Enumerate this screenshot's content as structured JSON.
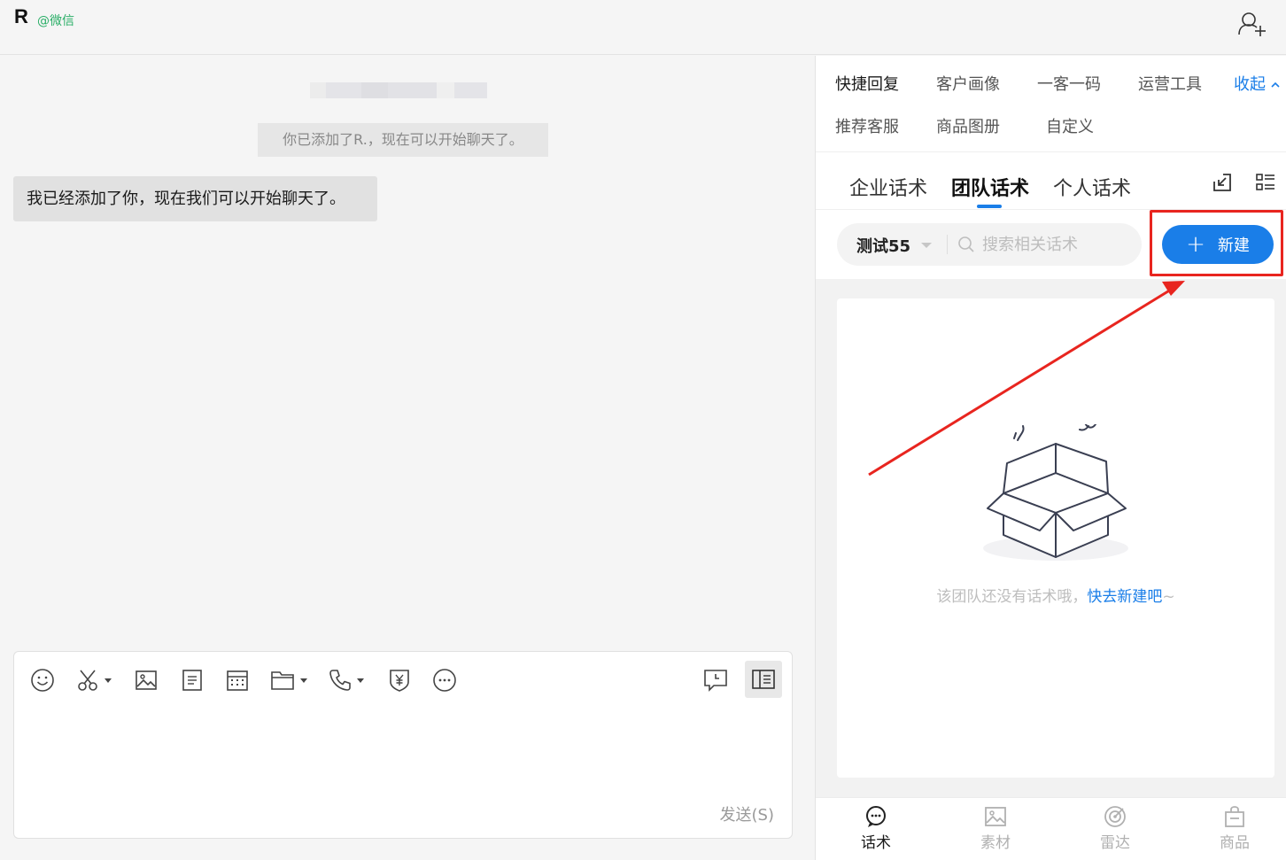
{
  "header": {
    "contact_name": "R",
    "source": "@微信",
    "add_contact_icon": "add-user-icon"
  },
  "chat": {
    "system_message": "你已添加了R.，现在可以开始聊天了。",
    "bubble_message": "我已经添加了你，现在我们可以开始聊天了。",
    "send_label": "发送(S)",
    "toolbar_icons": [
      "emoji-icon",
      "scissors-icon",
      "image-icon",
      "document-icon",
      "calendar-icon",
      "folder-icon",
      "phone-icon",
      "payment-shield-icon",
      "more-icon",
      "schedule-message-icon",
      "side-panel-icon"
    ]
  },
  "panel": {
    "nav": {
      "row1": [
        "快捷回复",
        "客户画像",
        "一客一码",
        "运营工具"
      ],
      "collapse": "收起",
      "row2": [
        "推荐客服",
        "商品图册",
        "自定义"
      ]
    },
    "tabs": [
      "企业话术",
      "团队话术",
      "个人话术"
    ],
    "active_tab": "团队话术",
    "team_select": "测试55",
    "search_placeholder": "搜索相关话术",
    "new_button": "新建",
    "empty_text": "该团队还没有话术哦，",
    "empty_link": "快去新建吧",
    "empty_suffix": "~",
    "bottom_nav": [
      "话术",
      "素材",
      "雷达",
      "商品"
    ],
    "colors": {
      "accent": "#1a7ee8",
      "highlight": "#e8251f"
    }
  }
}
